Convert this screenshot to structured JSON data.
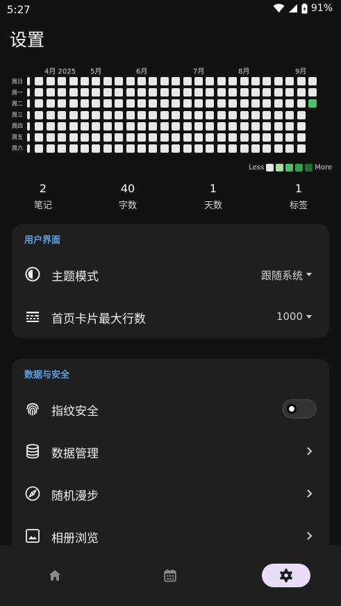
{
  "status_bar": {
    "time": "5:27",
    "battery": "91%"
  },
  "page_title": "设置",
  "heatmap": {
    "months": [
      "4月 2025",
      "5月",
      "6月",
      "7月",
      "8月",
      "9月"
    ],
    "days": [
      "周日",
      "周一",
      "周二",
      "周三",
      "周四",
      "周五",
      "周六"
    ],
    "active_cells": [
      {
        "week": 25,
        "day": 2,
        "level": 2
      }
    ],
    "legend": {
      "less": "Less",
      "more": "More",
      "colors": [
        "#e8e8e8",
        "#a6e3a1",
        "#4cc36a",
        "#2ea14a",
        "#1f6e33"
      ]
    }
  },
  "stats": [
    {
      "value": "2",
      "label": "笔记"
    },
    {
      "value": "40",
      "label": "字数"
    },
    {
      "value": "1",
      "label": "天数"
    },
    {
      "value": "1",
      "label": "标签"
    }
  ],
  "ui_section": {
    "header": "用户界面",
    "theme": {
      "label": "主题模式",
      "value": "跟随系统"
    },
    "max_lines": {
      "label": "首页卡片最大行数",
      "value": "1000"
    }
  },
  "data_section": {
    "header": "数据与安全",
    "fingerprint": {
      "label": "指纹安全",
      "enabled": false
    },
    "data_mgmt": {
      "label": "数据管理"
    },
    "random_walk": {
      "label": "随机漫步"
    },
    "gallery": {
      "label": "相册浏览"
    }
  },
  "bottom_nav": {
    "active": "settings"
  },
  "colors": {
    "accent": "#5aa2e6",
    "nav_active_bg": "#e9def8",
    "card_bg": "#1f1f1f"
  }
}
